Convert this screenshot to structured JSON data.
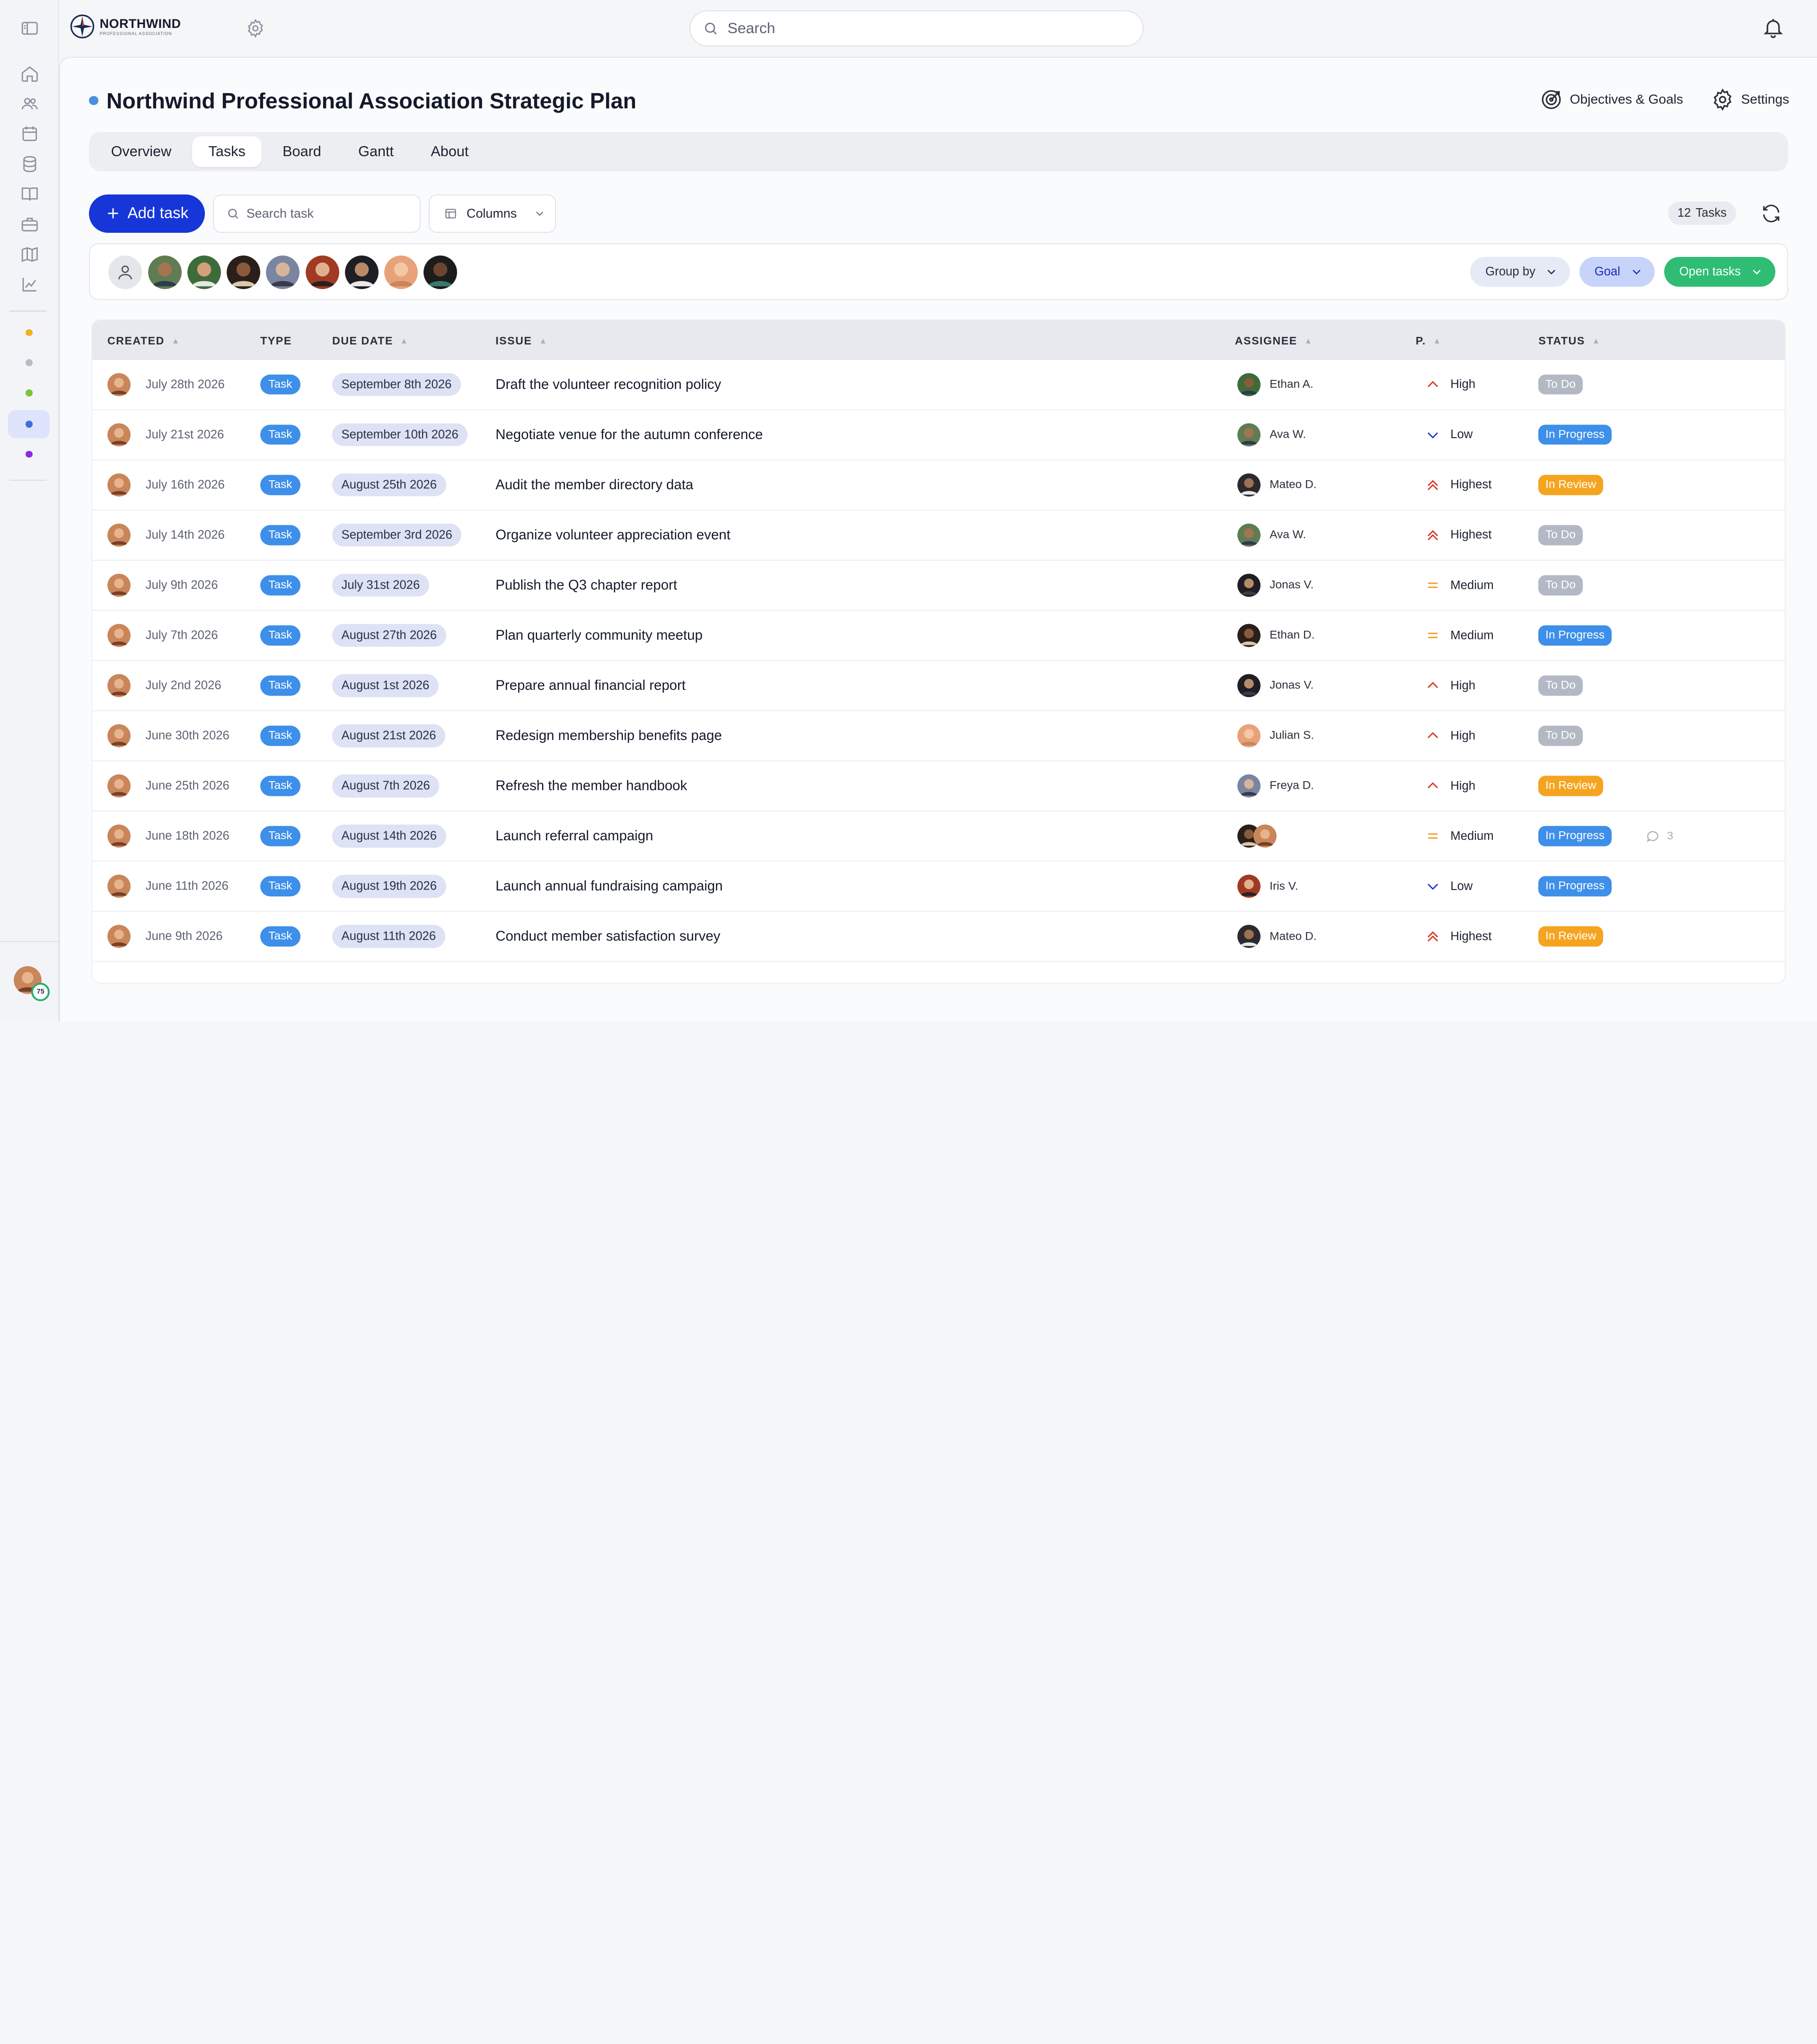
{
  "app": {
    "brand": "NORTHWIND",
    "brand_sub": "PROFESSIONAL ASSOCIATION",
    "search_placeholder": "Search",
    "user_level": "75"
  },
  "sidebar": {
    "icons": [
      "panel-toggle-icon",
      "home-icon",
      "users-icon",
      "calendar-icon",
      "database-icon",
      "book-icon",
      "briefcase-icon",
      "map-icon",
      "chart-icon"
    ],
    "project_dots": [
      {
        "color": "#f2b01e"
      },
      {
        "color": "#b8bcc6"
      },
      {
        "color": "#7cc23a"
      },
      {
        "color": "#3d6fd8",
        "selected": true
      },
      {
        "color": "#8a2be2"
      }
    ]
  },
  "page": {
    "title": "Northwind Professional Association Strategic Plan",
    "actions": {
      "objectives": "Objectives & Goals",
      "settings": "Settings"
    },
    "tabs": [
      "Overview",
      "Tasks",
      "Board",
      "Gantt",
      "About"
    ],
    "active_tab": "Tasks"
  },
  "toolbar": {
    "add_task": "Add task",
    "search_placeholder": "Search task",
    "columns": "Columns",
    "task_count": "12",
    "task_count_label": "Tasks"
  },
  "filters": {
    "group_by": "Group by",
    "goal": "Goal",
    "open_tasks": "Open tasks"
  },
  "table": {
    "headers": {
      "created": "CREATED",
      "type": "TYPE",
      "due_date": "DUE DATE",
      "issue": "ISSUE",
      "assignee": "ASSIGNEE",
      "priority": "P.",
      "status": "STATUS"
    },
    "rows": [
      {
        "created": "July 28th 2026",
        "type": "Task",
        "due": "September 8th 2026",
        "issue": "Draft the volunteer recognition policy",
        "assignee": "Ethan A.",
        "priority": "High",
        "status": "To Do"
      },
      {
        "created": "July 21st 2026",
        "type": "Task",
        "due": "September 10th 2026",
        "issue": "Negotiate venue for the autumn conference",
        "assignee": "Ava W.",
        "priority": "Low",
        "status": "In Progress"
      },
      {
        "created": "July 16th 2026",
        "type": "Task",
        "due": "August 25th 2026",
        "issue": "Audit the member directory data",
        "assignee": "Mateo D.",
        "priority": "Highest",
        "status": "In Review"
      },
      {
        "created": "July 14th 2026",
        "type": "Task",
        "due": "September 3rd 2026",
        "issue": "Organize volunteer appreciation event",
        "assignee": "Ava W.",
        "priority": "Highest",
        "status": "To Do"
      },
      {
        "created": "July 9th 2026",
        "type": "Task",
        "due": "July 31st 2026",
        "issue": "Publish the Q3 chapter report",
        "assignee": "Jonas V.",
        "priority": "Medium",
        "status": "To Do"
      },
      {
        "created": "July 7th 2026",
        "type": "Task",
        "due": "August 27th 2026",
        "issue": "Plan quarterly community meetup",
        "assignee": "Ethan D.",
        "priority": "Medium",
        "status": "In Progress"
      },
      {
        "created": "July 2nd 2026",
        "type": "Task",
        "due": "August 1st 2026",
        "issue": "Prepare annual financial report",
        "assignee": "Jonas V.",
        "priority": "High",
        "status": "To Do"
      },
      {
        "created": "June 30th 2026",
        "type": "Task",
        "due": "August 21st 2026",
        "issue": "Redesign membership benefits page",
        "assignee": "Julian S.",
        "priority": "High",
        "status": "To Do"
      },
      {
        "created": "June 25th 2026",
        "type": "Task",
        "due": "August 7th 2026",
        "issue": "Refresh the member handbook",
        "assignee": "Freya D.",
        "priority": "High",
        "status": "In Review"
      },
      {
        "created": "June 18th 2026",
        "type": "Task",
        "due": "August 14th 2026",
        "issue": "Launch referral campaign",
        "assignee": "",
        "priority": "Medium",
        "status": "In Progress",
        "comments": "3"
      },
      {
        "created": "June 11th 2026",
        "type": "Task",
        "due": "August 19th 2026",
        "issue": "Launch annual fundraising campaign",
        "assignee": "Iris V.",
        "priority": "Low",
        "status": "In Progress"
      },
      {
        "created": "June 9th 2026",
        "type": "Task",
        "due": "August 11th 2026",
        "issue": "Conduct member satisfaction survey",
        "assignee": "Mateo D.",
        "priority": "Highest",
        "status": "In Review"
      }
    ]
  },
  "colors": {
    "accent": "#1636d8",
    "status_todo": "#b3b9c4",
    "status_progress": "#3d8fe9",
    "status_review": "#f5a41f",
    "open_tasks": "#2fbd74"
  }
}
